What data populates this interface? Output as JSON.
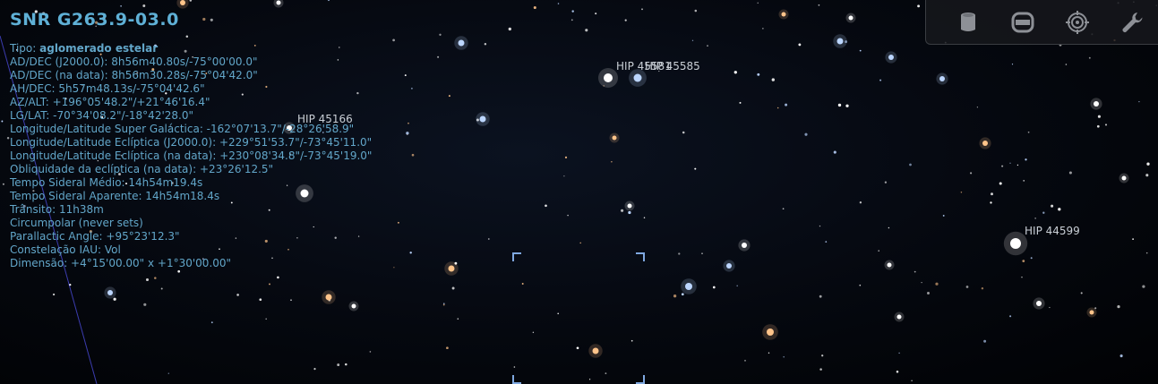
{
  "object": {
    "title": "SNR G263.9-03.0",
    "lines": [
      {
        "label": "Tipo: ",
        "value": "aglomerado estelar",
        "bold": true
      },
      {
        "label": "",
        "value": "AD/DEC (J2000.0): 8h56m40.80s/-75°00'00.0\""
      },
      {
        "label": "",
        "value": "AD/DEC (na data): 8h56m30.28s/-75°04'42.0\""
      },
      {
        "label": "",
        "value": "AH/DEC: 5h57m48.13s/-75°04'42.6\""
      },
      {
        "label": "",
        "value": "AZ/ALT: +196°05'48.2\"/+21°46'16.4\""
      },
      {
        "label": "",
        "value": "LG/LAT: -70°34'08.2\"/-18°42'28.0\""
      },
      {
        "label": "",
        "value": "Longitude/Latitude Super Galáctica: -162°07'13.7\"/-28°26'58.9\""
      },
      {
        "label": "",
        "value": "Longitude/Latitude Eclíptica (J2000.0): +229°51'53.7\"/-73°45'11.0\""
      },
      {
        "label": "",
        "value": "Longitude/Latitude Eclíptica (na data): +230°08'34.8\"/-73°45'19.0\""
      },
      {
        "label": "",
        "value": "Obliquidade da eclíptica (na data): +23°26'12.5\""
      },
      {
        "label": "",
        "value": "Tempo Sideral Médio: 14h54m19.4s"
      },
      {
        "label": "",
        "value": "Tempo Sideral Aparente: 14h54m18.4s"
      },
      {
        "label": "",
        "value": "Trânsito: 11h38m"
      },
      {
        "label": "",
        "value": "Circumpolar (never sets)"
      },
      {
        "label": "",
        "value": "Parallactic Angle: +95°23'12.3\""
      },
      {
        "label": "",
        "value": "Constelação IAU: Vol"
      },
      {
        "label": "",
        "value": "Dimensão: +4°15'00.00\" x +1°30'00.00\""
      }
    ]
  },
  "star_labels": [
    {
      "text": "HIP 45166"
    },
    {
      "text": "HIP 45581"
    },
    {
      "text": "HIP 45585"
    },
    {
      "text": "HIP 44599"
    }
  ],
  "toolbar": {
    "buttons": [
      {
        "name": "ground-toggle-button",
        "icon": "cylinder-icon"
      },
      {
        "name": "atmosphere-toggle-button",
        "icon": "rounded-square-icon"
      },
      {
        "name": "target-button",
        "icon": "target-icon"
      },
      {
        "name": "settings-button",
        "icon": "wrench-icon"
      }
    ]
  },
  "colors": {
    "info_text": "#62a6c9",
    "pointer": "#7fa8e0",
    "constellation_line": "#4a4ad8",
    "star_white": "#ffffff",
    "star_blue": "#bcd6ff",
    "star_orange": "#ffc48a"
  }
}
